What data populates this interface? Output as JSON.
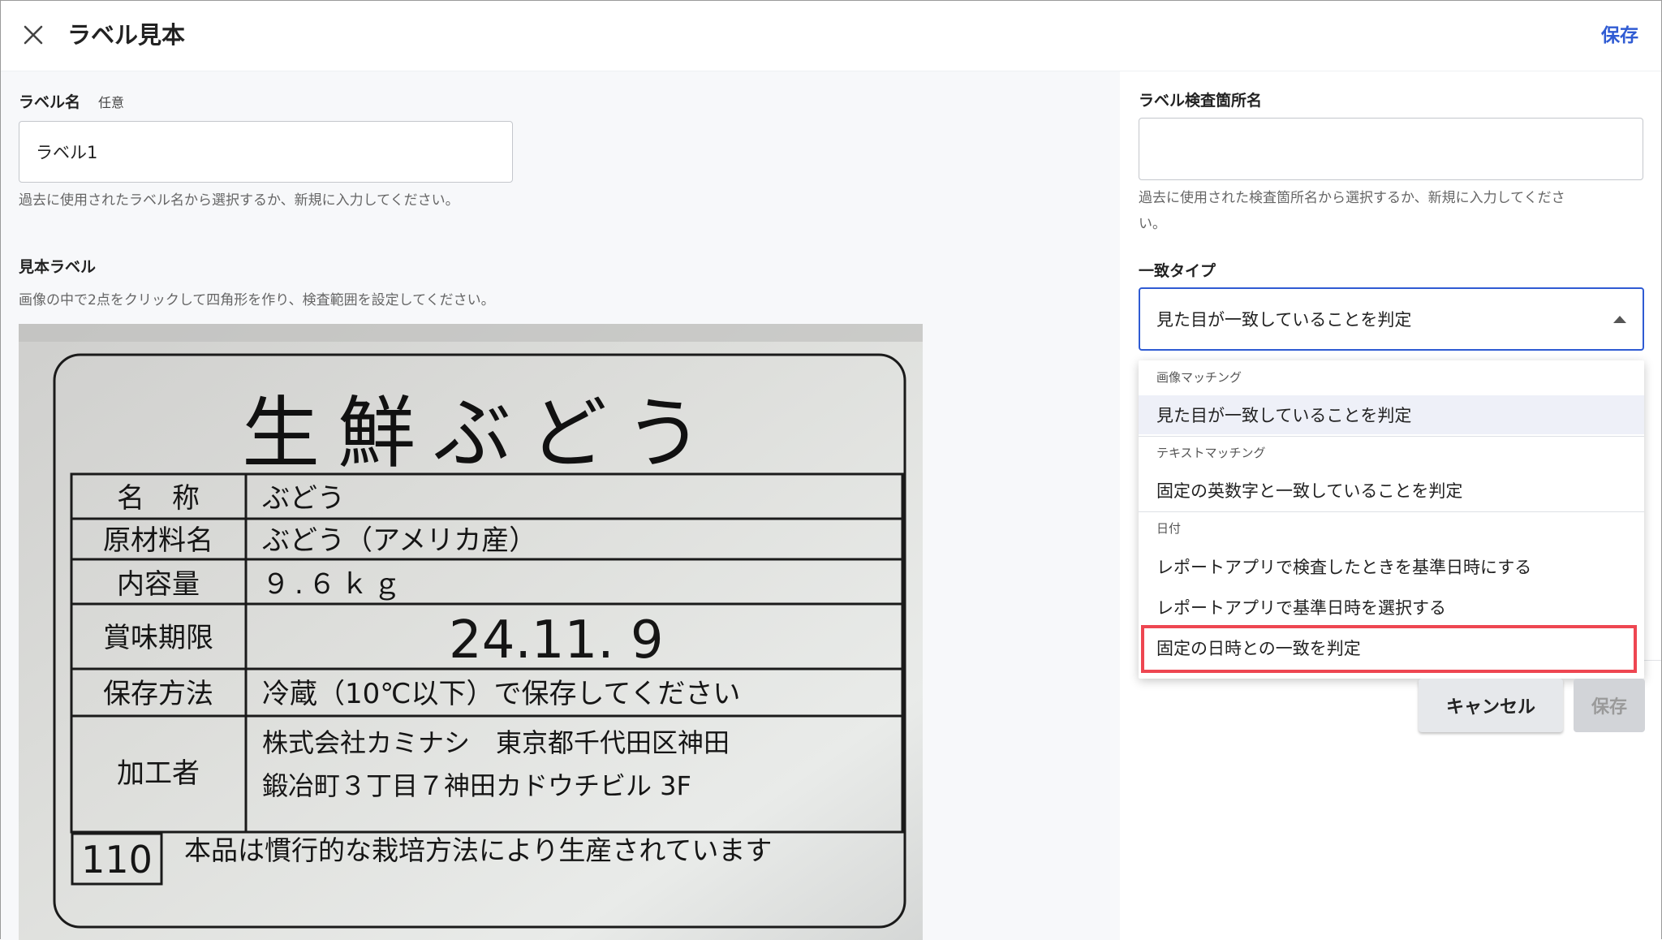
{
  "header": {
    "title": "ラベル見本",
    "save_link": "保存"
  },
  "left": {
    "label_name": {
      "label": "ラベル名",
      "optional": "任意",
      "value": "ラベル1",
      "help": "過去に使用されたラベル名から選択するか、新規に入力してください。"
    },
    "sample_label": {
      "label": "見本ラベル",
      "help": "画像の中で2点をクリックして四角形を作り、検査範囲を設定してください。"
    }
  },
  "image_text": {
    "heading": "生鮮ぶどう",
    "rows": [
      {
        "key": "名　称",
        "value": "ぶどう"
      },
      {
        "key": "原材料名",
        "value": "ぶどう（アメリカ産）"
      },
      {
        "key": "内容量",
        "value": "９.６ｋｇ"
      },
      {
        "key": "賞味期限",
        "value": "24.11. 9"
      },
      {
        "key": "保存方法",
        "value": "冷蔵（10℃以下）で保存してください"
      },
      {
        "key": "加工者",
        "value": "株式会社カミナシ　東京都千代田区神田",
        "value2": "鍛冶町３丁目７神田カドウチビル 3F"
      }
    ],
    "number_box": "110",
    "footer_note": "本品は慣行的な栽培方法により生産されています"
  },
  "right": {
    "location_name": {
      "label": "ラベル検査箇所名",
      "value": "",
      "help_line1": "過去に使用された検査箇所名から選択するか、新規に入力してくださ",
      "help_line2": "い。"
    },
    "match_type": {
      "label": "一致タイプ",
      "selected": "見た目が一致していることを判定"
    },
    "dropdown": {
      "groups": [
        {
          "label": "画像マッチング",
          "options": [
            "見た目が一致していることを判定"
          ]
        },
        {
          "label": "テキストマッチング",
          "options": [
            "固定の英数字と一致していることを判定"
          ]
        },
        {
          "label": "日付",
          "options": [
            "レポートアプリで検査したときを基準日時にする",
            "レポートアプリで基準日時を選択する",
            "固定の日時との一致を判定"
          ]
        }
      ]
    },
    "buttons": {
      "cancel": "キャンセル",
      "save": "保存"
    }
  },
  "colors": {
    "accent": "#2f5bd3",
    "highlight": "#ee4651",
    "left_bg": "#f7f8fa"
  }
}
